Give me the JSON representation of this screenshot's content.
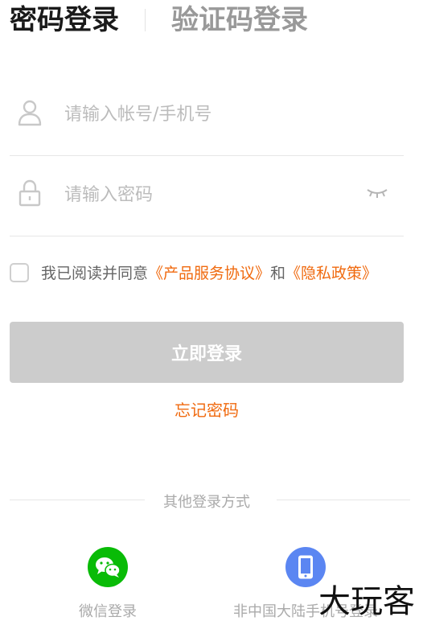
{
  "tabs": [
    {
      "label": "密码登录",
      "active": true
    },
    {
      "label": "验证码登录",
      "active": false
    }
  ],
  "account_field": {
    "placeholder": "请输入帐号/手机号",
    "value": ""
  },
  "password_field": {
    "placeholder": "请输入密码",
    "value": ""
  },
  "agreement": {
    "prefix": "我已阅读并同意",
    "terms_link": "《产品服务协议》",
    "and": "和",
    "privacy_link": "《隐私政策》",
    "checked": false
  },
  "login_button": "立即登录",
  "forgot_password": "忘记密码",
  "other_methods_label": "其他登录方式",
  "social": [
    {
      "label": "微信登录",
      "icon": "wechat-icon"
    },
    {
      "label": "非中国大陆手机号登录",
      "icon": "phone-icon"
    }
  ],
  "watermark": "大玩客",
  "colors": {
    "accent": "#f06a0f",
    "button_disabled": "#cccccc",
    "wechat": "#09bb07",
    "phone": "#5b86f2"
  }
}
